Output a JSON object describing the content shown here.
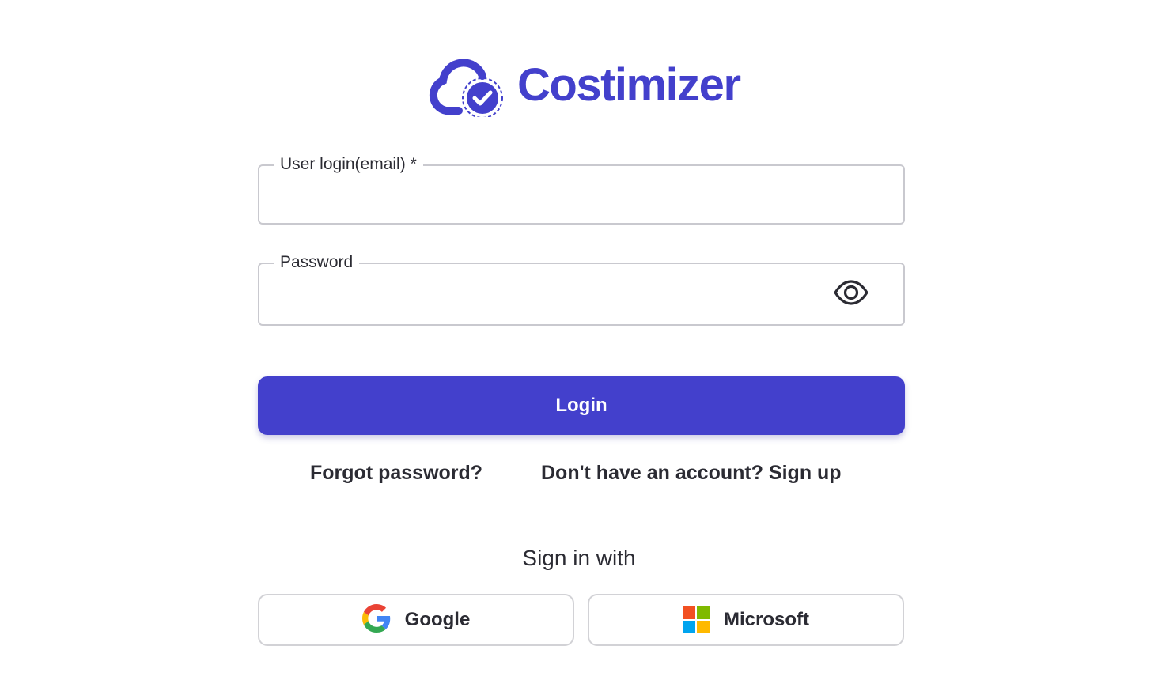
{
  "brand": {
    "name": "Costimizer",
    "logo_icon": "cloud-check-icon",
    "color": "#4340cc"
  },
  "form": {
    "email": {
      "label": "User login(email)",
      "required_mark": "*",
      "value": ""
    },
    "password": {
      "label": "Password",
      "value": "",
      "toggle_icon": "eye-icon"
    },
    "login_label": "Login"
  },
  "links": {
    "forgot_password": "Forgot password?",
    "signup": "Don't have an account? Sign up"
  },
  "sso": {
    "heading": "Sign in with",
    "providers": [
      {
        "label": "Google",
        "icon": "google-icon"
      },
      {
        "label": "Microsoft",
        "icon": "microsoft-icon"
      }
    ]
  },
  "colors": {
    "primary": "#4340cc",
    "text": "#2b2b33",
    "border": "#c9c9cf",
    "google_blue": "#4285F4",
    "google_red": "#EA4335",
    "google_yellow": "#FBBC05",
    "google_green": "#34A853",
    "ms_red": "#F25022",
    "ms_green": "#7FBA00",
    "ms_blue": "#00A4EF",
    "ms_yellow": "#FFB900"
  }
}
